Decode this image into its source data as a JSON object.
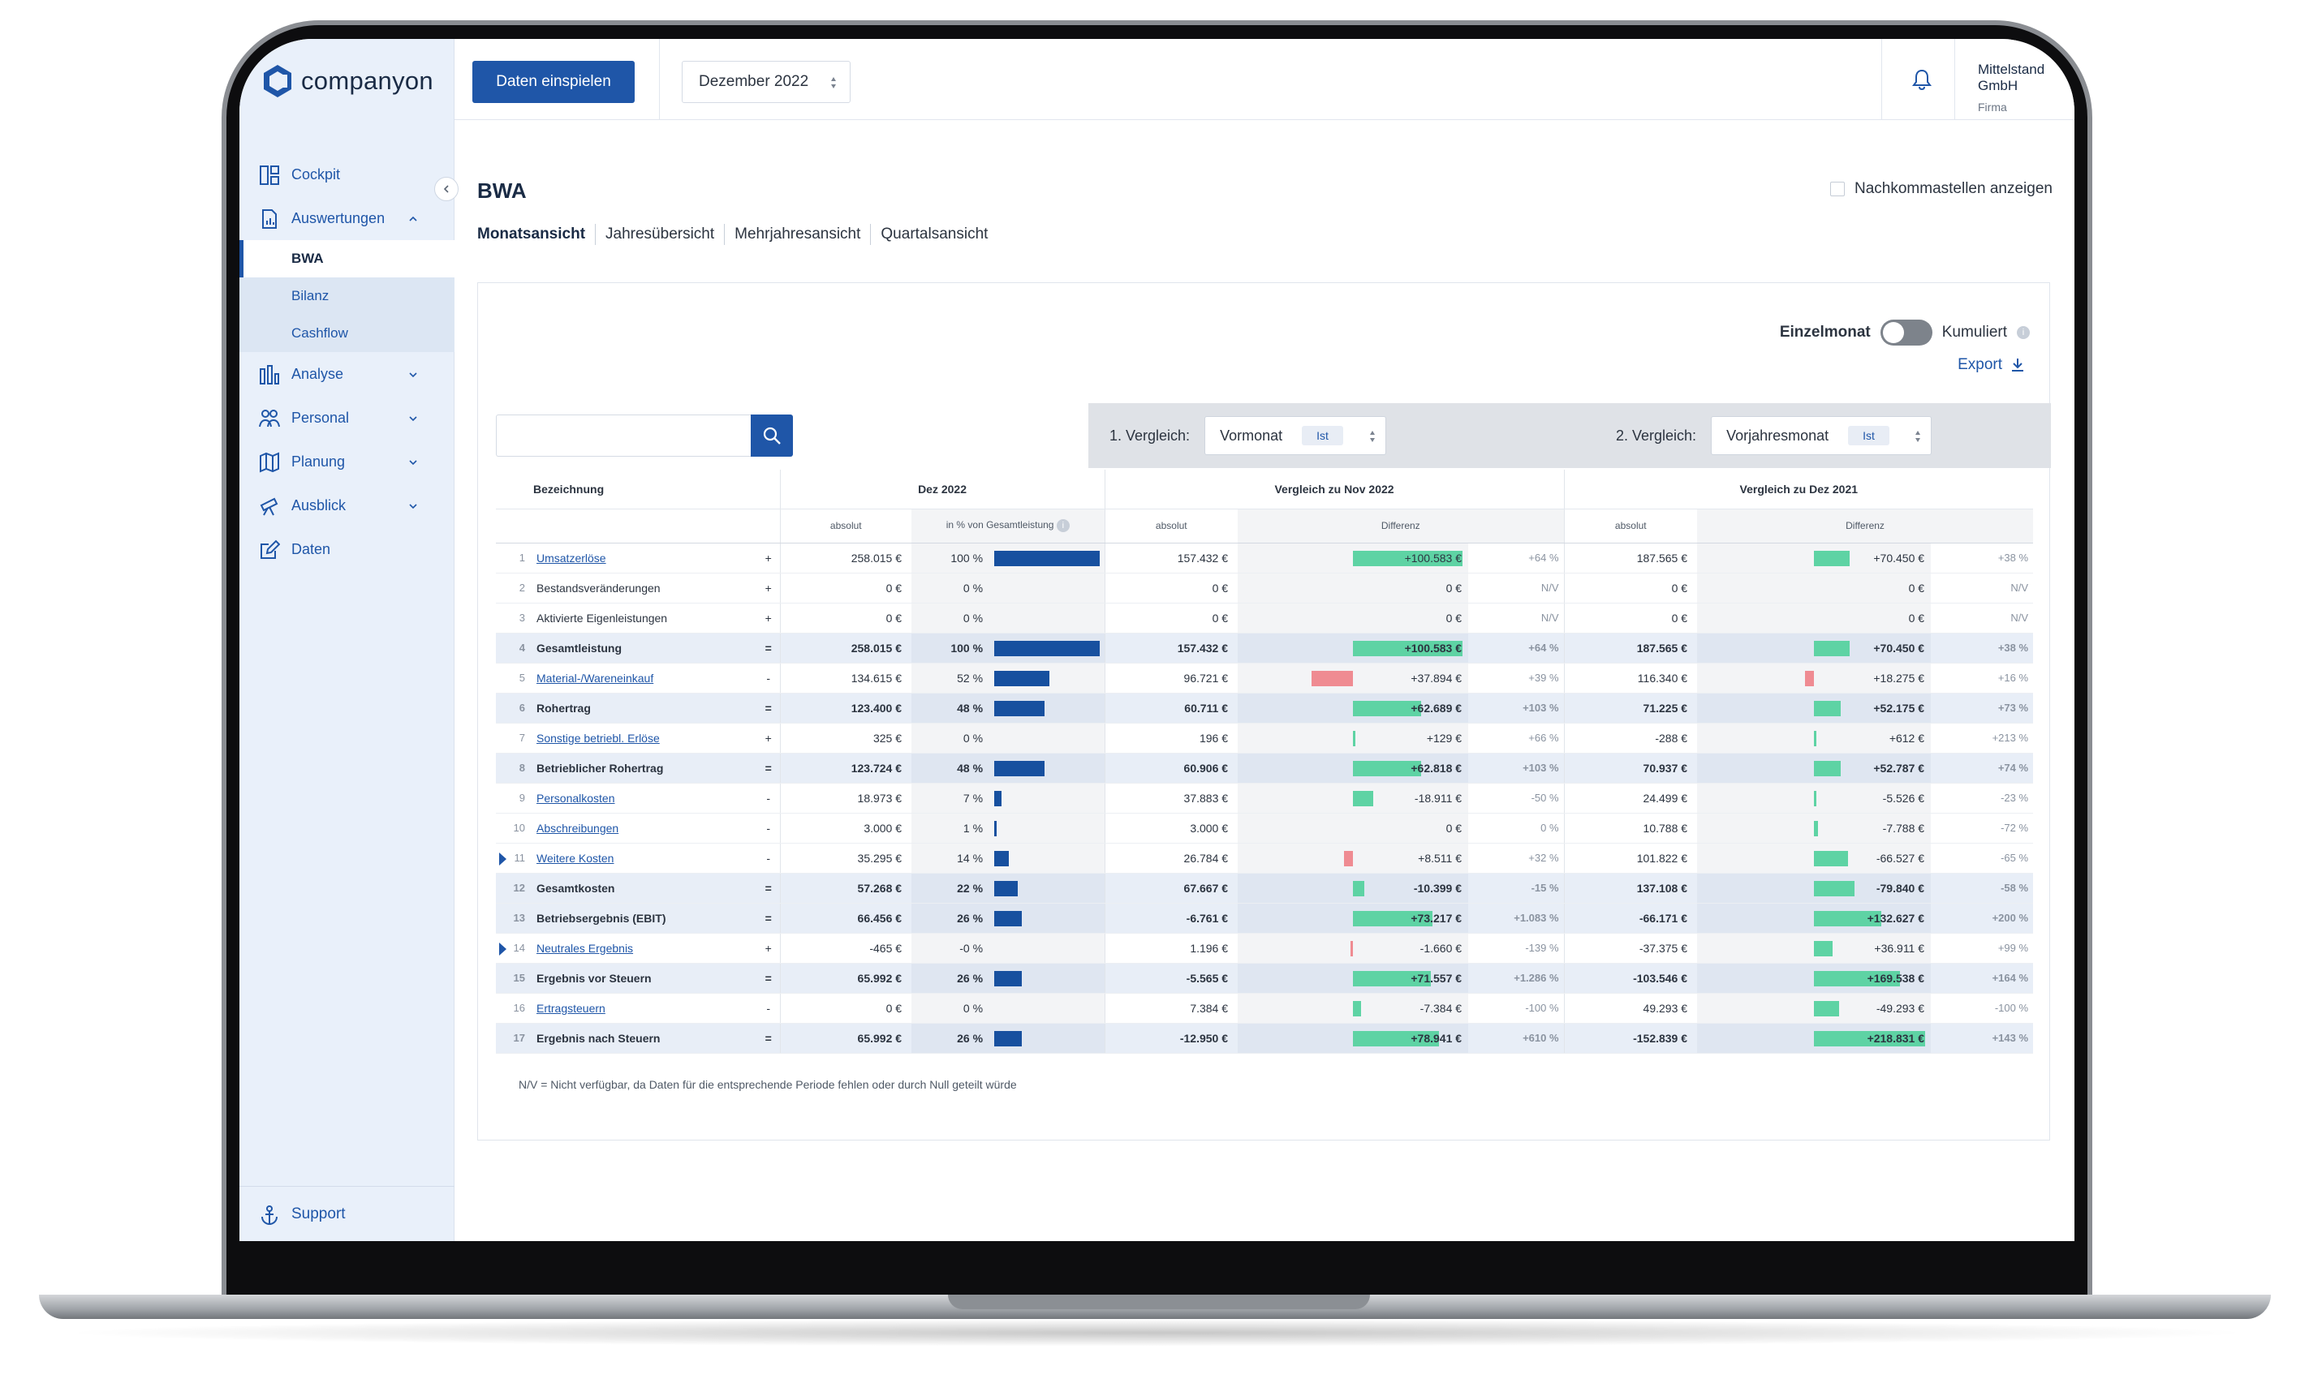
{
  "brand": {
    "name": "companyon",
    "accent": "#1f56a8"
  },
  "topbar": {
    "import_button": "Daten einspielen",
    "month": "Dezember 2022",
    "company_name": "Mittelstand GmbH",
    "company_type": "Firma"
  },
  "sidebar": {
    "items": [
      {
        "label": "Cockpit",
        "icon": "dashboard-icon"
      },
      {
        "label": "Auswertungen",
        "icon": "report-icon"
      },
      {
        "label": "Analyse",
        "icon": "bar-chart-icon"
      },
      {
        "label": "Personal",
        "icon": "people-icon"
      },
      {
        "label": "Planung",
        "icon": "map-icon"
      },
      {
        "label": "Ausblick",
        "icon": "telescope-icon"
      },
      {
        "label": "Daten",
        "icon": "edit-icon"
      }
    ],
    "sub_items": [
      "BWA",
      "Bilanz",
      "Cashflow"
    ],
    "support": "Support"
  },
  "page": {
    "title": "BWA",
    "decimals_label": "Nachkommastellen anzeigen",
    "tabs": [
      "Monatsansicht",
      "Jahresübersicht",
      "Mehrjahresansicht",
      "Quartalsansicht"
    ]
  },
  "controls": {
    "toggle_left": "Einzelmonat",
    "toggle_right": "Kumuliert",
    "export": "Export",
    "cmp1_label": "1. Vergleich:",
    "cmp1_value": "Vormonat",
    "cmp1_pill": "Ist",
    "cmp2_label": "2. Vergleich:",
    "cmp2_value": "Vorjahresmonat",
    "cmp2_pill": "Ist"
  },
  "table": {
    "headers": {
      "bezeichnung": "Bezeichnung",
      "period": "Dez 2022",
      "cmp1": "Vergleich zu Nov 2022",
      "cmp2": "Vergleich zu Dez 2021",
      "absolut": "absolut",
      "pct_total": "in % von Gesamtleistung",
      "differenz": "Differenz"
    },
    "rows": [
      {
        "n": "1",
        "label": "Umsatzerlöse",
        "link": true,
        "sum": false,
        "caret": false,
        "op": "+",
        "abs": "258.015 €",
        "pct": "100 %",
        "pct_val": 100,
        "c1_abs": "157.432 €",
        "c1_diff": "+100.583 €",
        "c1_dv": 100583,
        "c1_pct": "+64 %",
        "c2_abs": "187.565 €",
        "c2_diff": "+70.450 €",
        "c2_dv": 70450,
        "c2_pct": "+38 %"
      },
      {
        "n": "2",
        "label": "Bestandsveränderungen",
        "link": false,
        "sum": false,
        "caret": false,
        "op": "+",
        "abs": "0 €",
        "pct": "0 %",
        "pct_val": 0,
        "c1_abs": "0 €",
        "c1_diff": "0 €",
        "c1_dv": 0,
        "c1_pct": "N/V",
        "c2_abs": "0 €",
        "c2_diff": "0 €",
        "c2_dv": 0,
        "c2_pct": "N/V"
      },
      {
        "n": "3",
        "label": "Aktivierte Eigenleistungen",
        "link": false,
        "sum": false,
        "caret": false,
        "op": "+",
        "abs": "0 €",
        "pct": "0 %",
        "pct_val": 0,
        "c1_abs": "0 €",
        "c1_diff": "0 €",
        "c1_dv": 0,
        "c1_pct": "N/V",
        "c2_abs": "0 €",
        "c2_diff": "0 €",
        "c2_dv": 0,
        "c2_pct": "N/V"
      },
      {
        "n": "4",
        "label": "Gesamtleistung",
        "link": false,
        "sum": true,
        "caret": false,
        "op": "=",
        "abs": "258.015 €",
        "pct": "100 %",
        "pct_val": 100,
        "c1_abs": "157.432 €",
        "c1_diff": "+100.583 €",
        "c1_dv": 100583,
        "c1_pct": "+64 %",
        "c2_abs": "187.565 €",
        "c2_diff": "+70.450 €",
        "c2_dv": 70450,
        "c2_pct": "+38 %"
      },
      {
        "n": "5",
        "label": "Material-/Wareneinkauf",
        "link": true,
        "sum": false,
        "caret": false,
        "op": "-",
        "abs": "134.615 €",
        "pct": "52 %",
        "pct_val": 52,
        "c1_abs": "96.721 €",
        "c1_diff": "+37.894 €",
        "c1_dv": -37894,
        "c1_pct": "+39 %",
        "c2_abs": "116.340 €",
        "c2_diff": "+18.275 €",
        "c2_dv": -18275,
        "c2_pct": "+16 %"
      },
      {
        "n": "6",
        "label": "Rohertrag",
        "link": false,
        "sum": true,
        "caret": false,
        "op": "=",
        "abs": "123.400 €",
        "pct": "48 %",
        "pct_val": 48,
        "c1_abs": "60.711 €",
        "c1_diff": "+62.689 €",
        "c1_dv": 62689,
        "c1_pct": "+103 %",
        "c2_abs": "71.225 €",
        "c2_diff": "+52.175 €",
        "c2_dv": 52175,
        "c2_pct": "+73 %"
      },
      {
        "n": "7",
        "label": "Sonstige betriebl. Erlöse",
        "link": true,
        "sum": false,
        "caret": false,
        "op": "+",
        "abs": "325 €",
        "pct": "0 %",
        "pct_val": 0,
        "c1_abs": "196 €",
        "c1_diff": "+129 €",
        "c1_dv": 129,
        "c1_pct": "+66 %",
        "c2_abs": "-288 €",
        "c2_diff": "+612 €",
        "c2_dv": 612,
        "c2_pct": "+213 %"
      },
      {
        "n": "8",
        "label": "Betrieblicher Rohertrag",
        "link": false,
        "sum": true,
        "caret": false,
        "op": "=",
        "abs": "123.724 €",
        "pct": "48 %",
        "pct_val": 48,
        "c1_abs": "60.906 €",
        "c1_diff": "+62.818 €",
        "c1_dv": 62818,
        "c1_pct": "+103 %",
        "c2_abs": "70.937 €",
        "c2_diff": "+52.787 €",
        "c2_dv": 52787,
        "c2_pct": "+74 %"
      },
      {
        "n": "9",
        "label": "Personalkosten",
        "link": true,
        "sum": false,
        "caret": false,
        "op": "-",
        "abs": "18.973 €",
        "pct": "7 %",
        "pct_val": 7,
        "c1_abs": "37.883 €",
        "c1_diff": "-18.911 €",
        "c1_dv": 18911,
        "c1_pct": "-50 %",
        "c2_abs": "24.499 €",
        "c2_diff": "-5.526 €",
        "c2_dv": 5526,
        "c2_pct": "-23 %"
      },
      {
        "n": "10",
        "label": "Abschreibungen",
        "link": true,
        "sum": false,
        "caret": false,
        "op": "-",
        "abs": "3.000 €",
        "pct": "1 %",
        "pct_val": 1,
        "c1_abs": "3.000 €",
        "c1_diff": "0 €",
        "c1_dv": 0,
        "c1_pct": "0 %",
        "c2_abs": "10.788 €",
        "c2_diff": "-7.788 €",
        "c2_dv": 7788,
        "c2_pct": "-72 %"
      },
      {
        "n": "11",
        "label": "Weitere Kosten",
        "link": true,
        "sum": false,
        "caret": true,
        "op": "-",
        "abs": "35.295 €",
        "pct": "14 %",
        "pct_val": 14,
        "c1_abs": "26.784 €",
        "c1_diff": "+8.511 €",
        "c1_dv": -8511,
        "c1_pct": "+32 %",
        "c2_abs": "101.822 €",
        "c2_diff": "-66.527 €",
        "c2_dv": 66527,
        "c2_pct": "-65 %"
      },
      {
        "n": "12",
        "label": "Gesamtkosten",
        "link": false,
        "sum": true,
        "caret": false,
        "op": "=",
        "abs": "57.268 €",
        "pct": "22 %",
        "pct_val": 22,
        "c1_abs": "67.667 €",
        "c1_diff": "-10.399 €",
        "c1_dv": 10399,
        "c1_pct": "-15 %",
        "c2_abs": "137.108 €",
        "c2_diff": "-79.840 €",
        "c2_dv": 79840,
        "c2_pct": "-58 %"
      },
      {
        "n": "13",
        "label": "Betriebsergebnis (EBIT)",
        "link": false,
        "sum": true,
        "caret": false,
        "op": "=",
        "abs": "66.456 €",
        "pct": "26 %",
        "pct_val": 26,
        "c1_abs": "-6.761 €",
        "c1_diff": "+73.217 €",
        "c1_dv": 73217,
        "c1_pct": "+1.083 %",
        "c2_abs": "-66.171 €",
        "c2_diff": "+132.627 €",
        "c2_dv": 132627,
        "c2_pct": "+200 %"
      },
      {
        "n": "14",
        "label": "Neutrales Ergebnis",
        "link": true,
        "sum": false,
        "caret": true,
        "op": "+",
        "abs": "-465 €",
        "pct": "-0 %",
        "pct_val": 0,
        "c1_abs": "1.196 €",
        "c1_diff": "-1.660 €",
        "c1_dv": -1660,
        "c1_pct": "-139 %",
        "c2_abs": "-37.375 €",
        "c2_diff": "+36.911 €",
        "c2_dv": 36911,
        "c2_pct": "+99 %"
      },
      {
        "n": "15",
        "label": "Ergebnis vor Steuern",
        "link": false,
        "sum": true,
        "caret": false,
        "op": "=",
        "abs": "65.992 €",
        "pct": "26 %",
        "pct_val": 26,
        "c1_abs": "-5.565 €",
        "c1_diff": "+71.557 €",
        "c1_dv": 71557,
        "c1_pct": "+1.286 %",
        "c2_abs": "-103.546 €",
        "c2_diff": "+169.538 €",
        "c2_dv": 169538,
        "c2_pct": "+164 %"
      },
      {
        "n": "16",
        "label": "Ertragsteuern",
        "link": true,
        "sum": false,
        "caret": false,
        "op": "-",
        "abs": "0 €",
        "pct": "0 %",
        "pct_val": 0,
        "c1_abs": "7.384 €",
        "c1_diff": "-7.384 €",
        "c1_dv": 7384,
        "c1_pct": "-100 %",
        "c2_abs": "49.293 €",
        "c2_diff": "-49.293 €",
        "c2_dv": 49293,
        "c2_pct": "-100 %"
      },
      {
        "n": "17",
        "label": "Ergebnis nach Steuern",
        "link": false,
        "sum": true,
        "caret": false,
        "op": "=",
        "abs": "65.992 €",
        "pct": "26 %",
        "pct_val": 26,
        "c1_abs": "-12.950 €",
        "c1_diff": "+78.941 €",
        "c1_dv": 78941,
        "c1_pct": "+610 %",
        "c2_abs": "-152.839 €",
        "c2_diff": "+218.831 €",
        "c2_dv": 218831,
        "c2_pct": "+143 %"
      }
    ],
    "footnote": "N/V = Nicht verfügbar, da Daten für die entsprechende Periode fehlen oder durch Null geteilt würde"
  },
  "colors": {
    "bar_period": "#17509f",
    "bar_positive": "#5ed3a4",
    "bar_negative": "#ef8b92"
  },
  "help_label": "?"
}
